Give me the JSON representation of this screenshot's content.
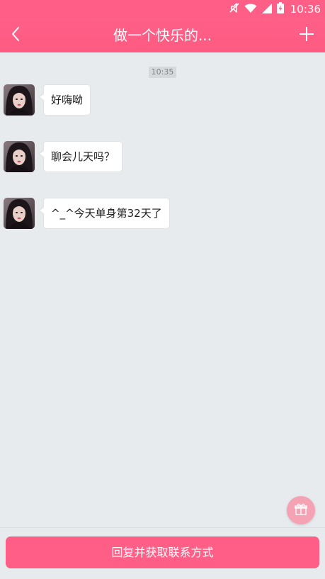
{
  "status_bar": {
    "time": "10:36",
    "icons": [
      "mute-icon",
      "wifi-icon",
      "signal-icon",
      "battery-charging-icon"
    ]
  },
  "header": {
    "title": "做一个快乐的...",
    "back_icon": "chevron-left-icon",
    "add_icon": "plus-icon"
  },
  "chat": {
    "timestamp": "10:35",
    "messages": [
      {
        "text": "好嗨呦"
      },
      {
        "text": "聊会儿天吗？"
      },
      {
        "text": "^_^今天单身第32天了"
      }
    ]
  },
  "gift_icon": "gift-icon",
  "reply_button": {
    "label": "回复并获取联系方式"
  },
  "colors": {
    "accent": "#ff5f86",
    "background": "#e8ebee",
    "bubble": "#ffffff",
    "gift": "#f5a2b4"
  }
}
